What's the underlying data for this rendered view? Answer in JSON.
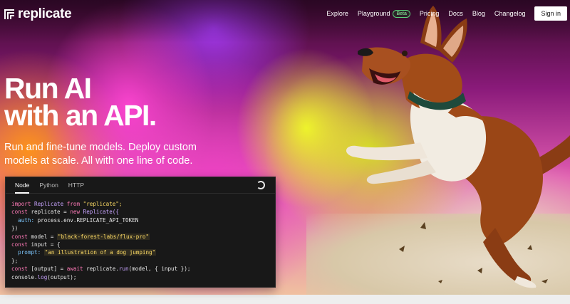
{
  "brand": {
    "name": "replicate"
  },
  "nav": {
    "items": [
      {
        "label": "Explore"
      },
      {
        "label": "Playground",
        "badge": "Beta"
      },
      {
        "label": "Pricing"
      },
      {
        "label": "Docs"
      },
      {
        "label": "Blog"
      },
      {
        "label": "Changelog"
      }
    ],
    "signin_label": "Sign in"
  },
  "hero": {
    "headline_line1": "Run AI",
    "headline_line2": "with an API.",
    "subhead": "Run and fine-tune models. Deploy custom models at scale. All with one line of code."
  },
  "code_panel": {
    "tabs": [
      {
        "label": "Node",
        "active": true
      },
      {
        "label": "Python",
        "active": false
      },
      {
        "label": "HTTP",
        "active": false
      }
    ],
    "lines": {
      "l1_import": "import",
      "l1_cls": "Replicate",
      "l1_from": "from",
      "l1_str": "\"replicate\";",
      "l2_const": "const",
      "l2_var": "replicate",
      "l2_eq": "=",
      "l2_new": "new",
      "l2_cls": "Replicate({",
      "l3_prop": "auth:",
      "l3_val": "process.env.REPLICATE_API_TOKEN",
      "l4": "})",
      "l5_const": "const",
      "l5_var": "model =",
      "l5_str": "\"black-forest-labs/flux-pro\"",
      "l6_const": "const",
      "l6_var": "input = {",
      "l7_prop": "prompt:",
      "l7_str": "\"an illustration of a dog jumping\"",
      "l8": "};",
      "l9_const": "const",
      "l9_var": "[output] =",
      "l9_await": "await",
      "l9_obj": "replicate.",
      "l9_fn": "run",
      "l9_rest": "(model, { input });",
      "l10_obj": "console.",
      "l10_fn": "log",
      "l10_rest": "(output);"
    }
  },
  "colors": {
    "accent_beta": "#5cd07a",
    "code_bg": "#181818",
    "keyword": "#ff7ab8",
    "string": "#ffdd66"
  }
}
